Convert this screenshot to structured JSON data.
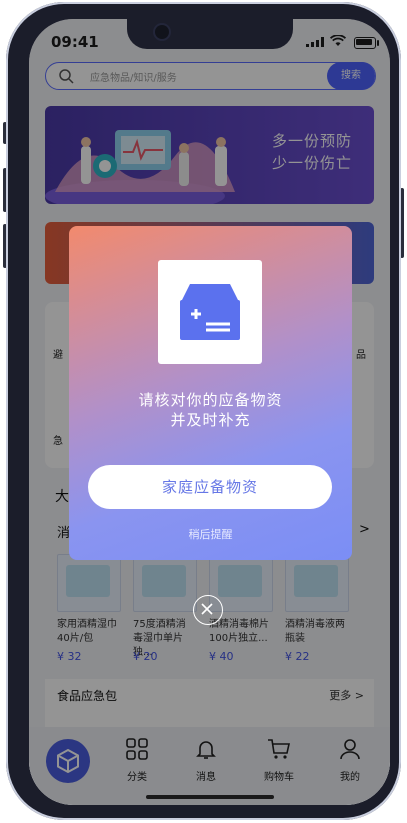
{
  "status": {
    "time": "09:41"
  },
  "search": {
    "placeholder": "应急物品/知识/服务",
    "button": "搜索"
  },
  "banner": {
    "slogan_line1": "多一份预防",
    "slogan_line2": "少一份伤亡"
  },
  "panel": {
    "title": "大",
    "partial_left": "避",
    "partial_right": "品",
    "partial_left2": "急"
  },
  "section": {
    "title": "消",
    "more": ">"
  },
  "products": [
    {
      "name": "家用酒精湿巾40片/包",
      "price": "¥ 32"
    },
    {
      "name": "75度酒精消毒湿巾单片独...",
      "price": "¥ 20"
    },
    {
      "name": "酒精消毒棉片100片独立...",
      "price": "¥ 40"
    },
    {
      "name": "酒精消毒液两瓶装",
      "price": "¥ 22"
    }
  ],
  "food": {
    "title": "食品应急包",
    "more": "更多 >"
  },
  "tabbar": [
    {
      "label": "分类",
      "icon": "grid-icon"
    },
    {
      "label": "消息",
      "icon": "bell-icon"
    },
    {
      "label": "购物车",
      "icon": "cart-icon"
    },
    {
      "label": "我的",
      "icon": "user-icon"
    }
  ],
  "modal": {
    "line1": "请核对你的应备物资",
    "line2": "并及时补充",
    "cta": "家庭应备物资",
    "later": "稍后提醒"
  },
  "colors": {
    "accent": "#4e63ff",
    "modal_gradient_start": "#f28a6d",
    "modal_gradient_end": "#7b8ef5"
  }
}
